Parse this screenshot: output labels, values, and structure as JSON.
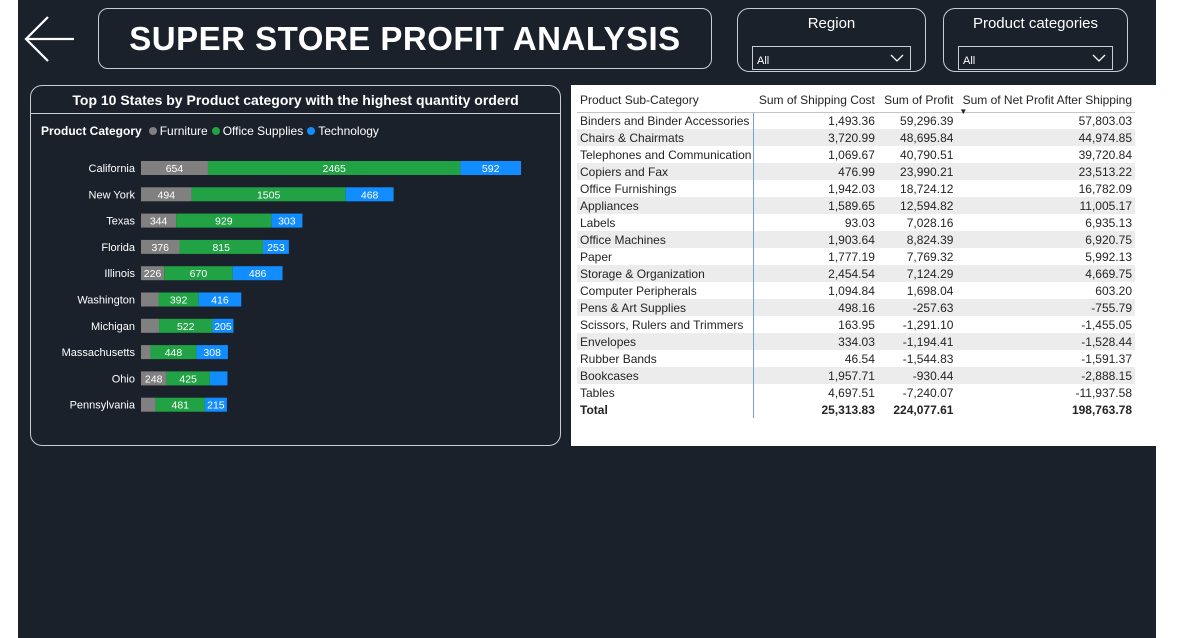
{
  "colors": {
    "canvas": "#1b212b",
    "furniture": "#808080",
    "office_supplies": "#21a345",
    "technology": "#118dff",
    "border": "#c8ccd3"
  },
  "header": {
    "back_icon": "arrow-left-icon",
    "title": "SUPER STORE PROFIT ANALYSIS"
  },
  "slicers": {
    "region": {
      "title": "Region",
      "value": "All"
    },
    "category": {
      "title": "Product categories",
      "value": "All"
    }
  },
  "chart_data": {
    "type": "bar",
    "orientation": "horizontal",
    "stacked": true,
    "title": "Top 10 States by Product category with the highest quantity orderd",
    "legend_title": "Product Category",
    "legend_position": "top-left",
    "categories": [
      "California",
      "New York",
      "Texas",
      "Florida",
      "Illinois",
      "Washington",
      "Michigan",
      "Massachusetts",
      "Ohio",
      "Pennsylvania"
    ],
    "series": [
      {
        "name": "Furniture",
        "color": "#808080",
        "values": [
          654,
          494,
          344,
          376,
          226,
          171,
          176,
          93,
          248,
          143
        ]
      },
      {
        "name": "Office Supplies",
        "color": "#21a345",
        "values": [
          2465,
          1505,
          929,
          815,
          670,
          392,
          522,
          448,
          425,
          481
        ]
      },
      {
        "name": "Technology",
        "color": "#118dff",
        "values": [
          592,
          468,
          303,
          253,
          486,
          416,
          205,
          308,
          171,
          215
        ]
      }
    ],
    "data_labels": [
      [
        "654",
        "2465",
        "592"
      ],
      [
        "494",
        "1505",
        "468"
      ],
      [
        "344",
        "929",
        "303"
      ],
      [
        "376",
        "815",
        "253"
      ],
      [
        "226",
        "670",
        "486"
      ],
      [
        "",
        "392",
        "416"
      ],
      [
        "",
        "522",
        "205"
      ],
      [
        "",
        "448",
        "308"
      ],
      [
        "248",
        "425",
        ""
      ],
      [
        "",
        "481",
        "215"
      ]
    ],
    "xlim": [
      0,
      3750
    ],
    "grid": false
  },
  "table": {
    "headers": [
      "Product Sub-Category",
      "Sum of Shipping Cost",
      "Sum of Profit",
      "Sum of Net Profit After Shipping"
    ],
    "sort_indicator": "▼",
    "rows": [
      [
        "Binders and Binder Accessories",
        "1,493.36",
        "59,296.39",
        "57,803.03"
      ],
      [
        "Chairs & Chairmats",
        "3,720.99",
        "48,695.84",
        "44,974.85"
      ],
      [
        "Telephones and Communication",
        "1,069.67",
        "40,790.51",
        "39,720.84"
      ],
      [
        "Copiers and Fax",
        "476.99",
        "23,990.21",
        "23,513.22"
      ],
      [
        "Office Furnishings",
        "1,942.03",
        "18,724.12",
        "16,782.09"
      ],
      [
        "Appliances",
        "1,589.65",
        "12,594.82",
        "11,005.17"
      ],
      [
        "Labels",
        "93.03",
        "7,028.16",
        "6,935.13"
      ],
      [
        "Office Machines",
        "1,903.64",
        "8,824.39",
        "6,920.75"
      ],
      [
        "Paper",
        "1,777.19",
        "7,769.32",
        "5,992.13"
      ],
      [
        "Storage & Organization",
        "2,454.54",
        "7,124.29",
        "4,669.75"
      ],
      [
        "Computer Peripherals",
        "1,094.84",
        "1,698.04",
        "603.20"
      ],
      [
        "Pens & Art Supplies",
        "498.16",
        "-257.63",
        "-755.79"
      ],
      [
        "Scissors, Rulers and Trimmers",
        "163.95",
        "-1,291.10",
        "-1,455.05"
      ],
      [
        "Envelopes",
        "334.03",
        "-1,194.41",
        "-1,528.44"
      ],
      [
        "Rubber Bands",
        "46.54",
        "-1,544.83",
        "-1,591.37"
      ],
      [
        "Bookcases",
        "1,957.71",
        "-930.44",
        "-2,888.15"
      ],
      [
        "Tables",
        "4,697.51",
        "-7,240.07",
        "-11,937.58"
      ]
    ],
    "total": [
      "Total",
      "25,313.83",
      "224,077.61",
      "198,763.78"
    ]
  }
}
